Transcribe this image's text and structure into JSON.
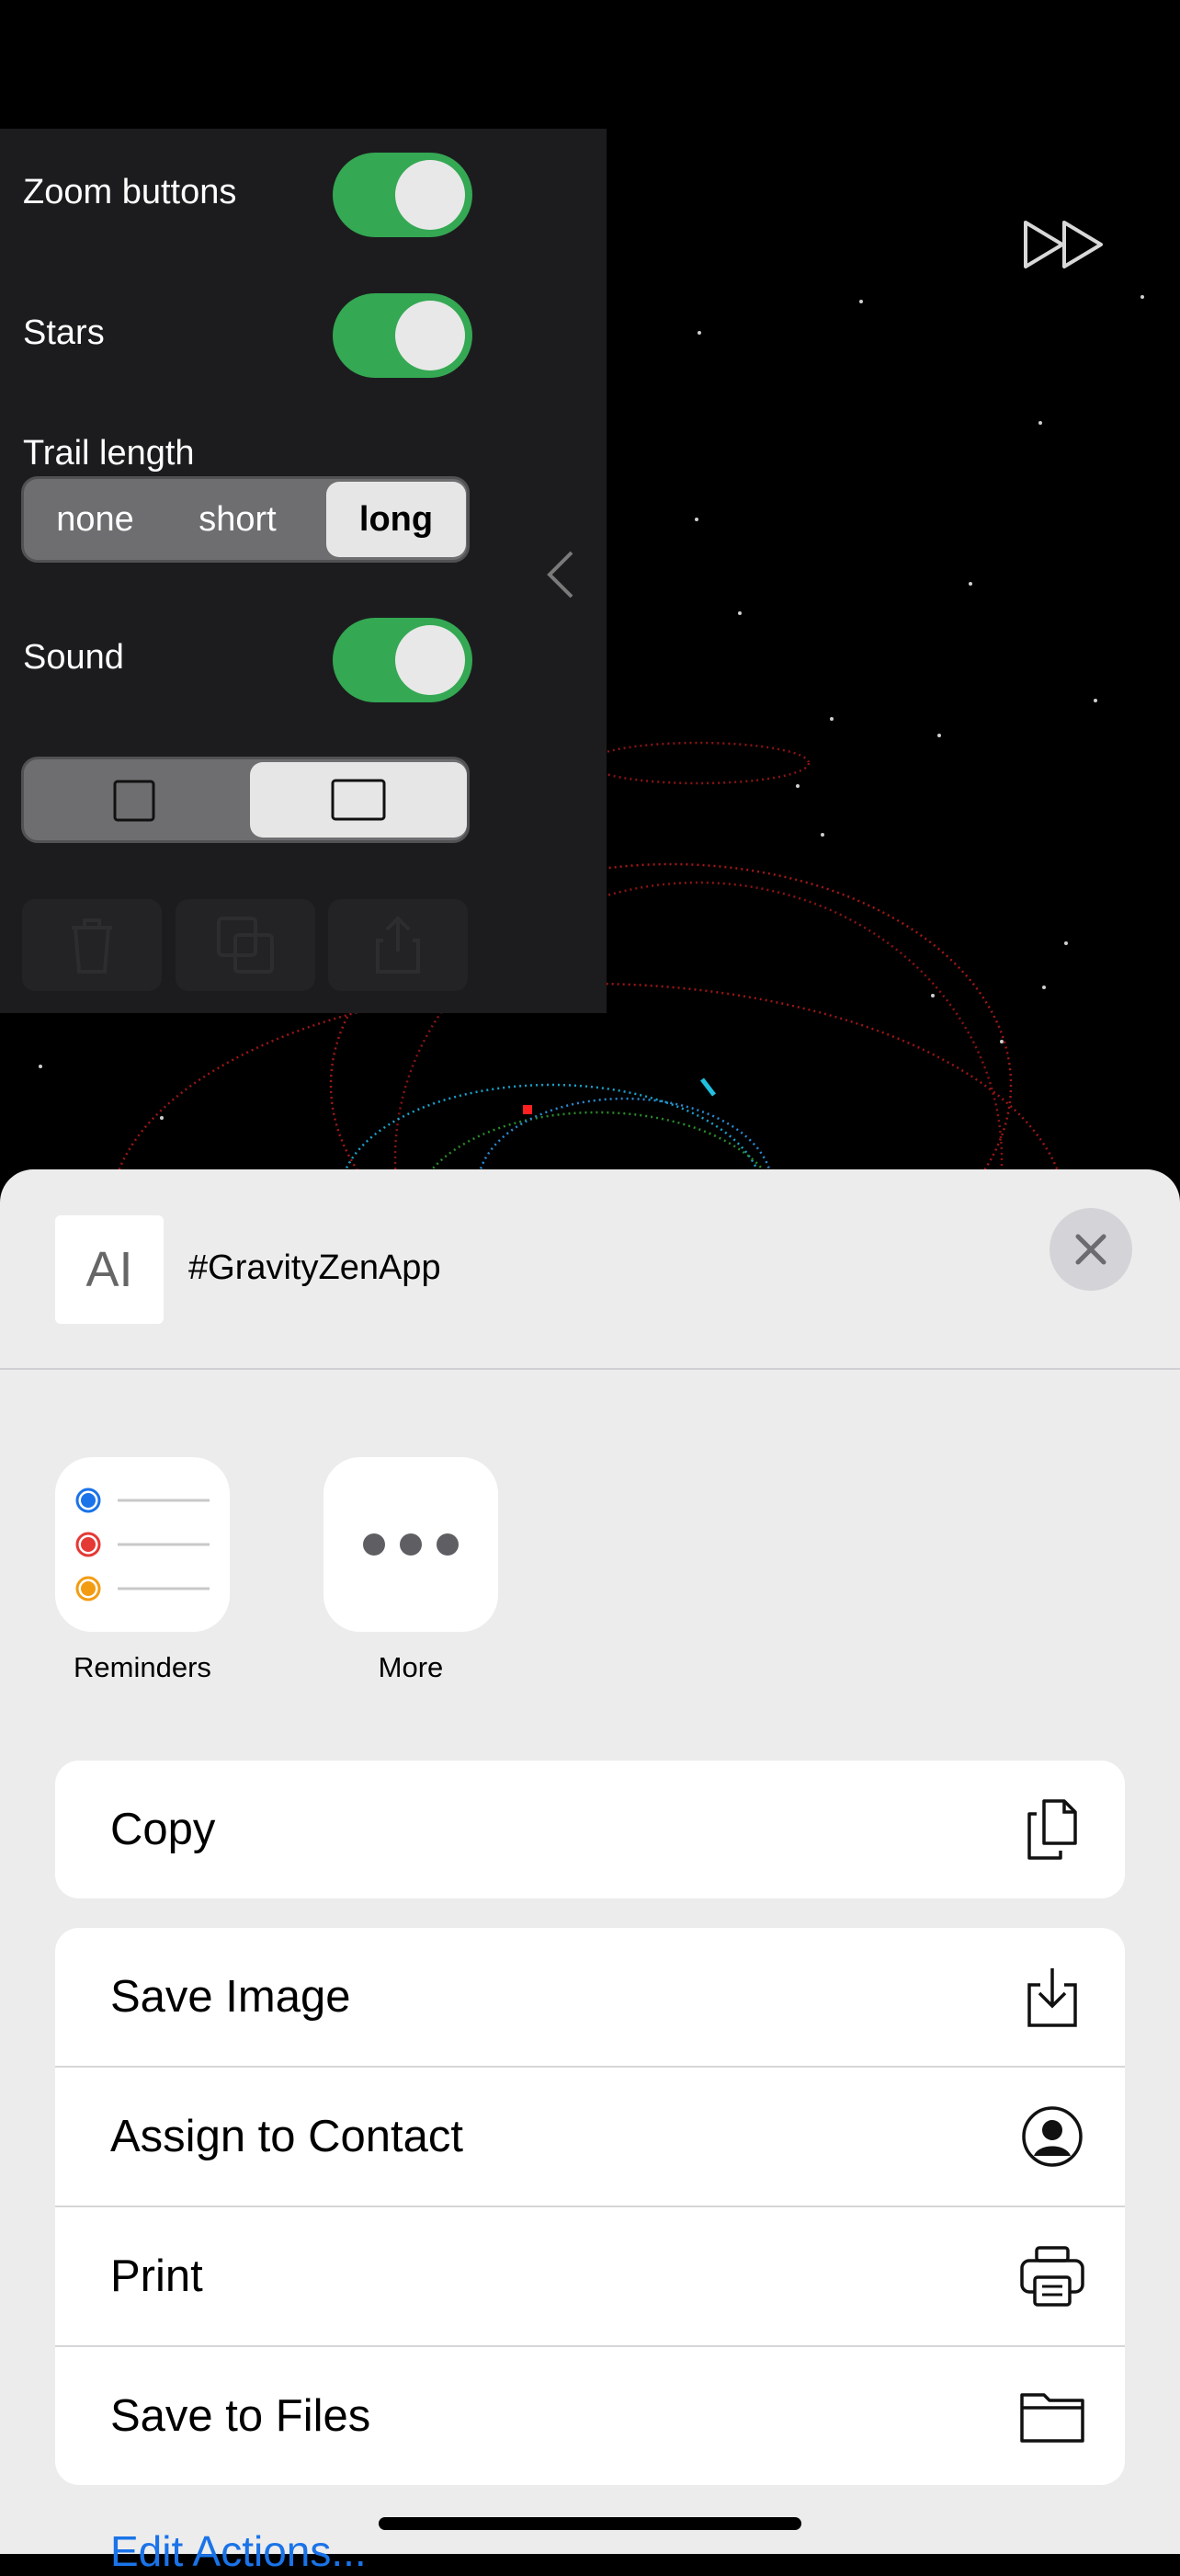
{
  "settings": {
    "zoom_buttons_label": "Zoom buttons",
    "zoom_buttons_on": true,
    "stars_label": "Stars",
    "stars_on": true,
    "trail_length_label": "Trail length",
    "trail_options": [
      "none",
      "short",
      "long"
    ],
    "trail_selected": "long",
    "sound_label": "Sound",
    "sound_on": true
  },
  "share_sheet": {
    "title": "#GravityZenApp",
    "apps": [
      {
        "label": "Reminders",
        "icon": "reminders-icon"
      },
      {
        "label": "More",
        "icon": "more-icon"
      }
    ],
    "copy_label": "Copy",
    "actions": [
      {
        "label": "Save Image",
        "icon": "save-image-icon"
      },
      {
        "label": "Assign to Contact",
        "icon": "contact-icon"
      },
      {
        "label": "Print",
        "icon": "printer-icon"
      },
      {
        "label": "Save to Files",
        "icon": "folder-icon"
      }
    ],
    "edit_actions_label": "Edit Actions..."
  },
  "colors": {
    "toggle_on": "#34a853",
    "sheet_bg": "#ececec",
    "link": "#1a73e8"
  }
}
